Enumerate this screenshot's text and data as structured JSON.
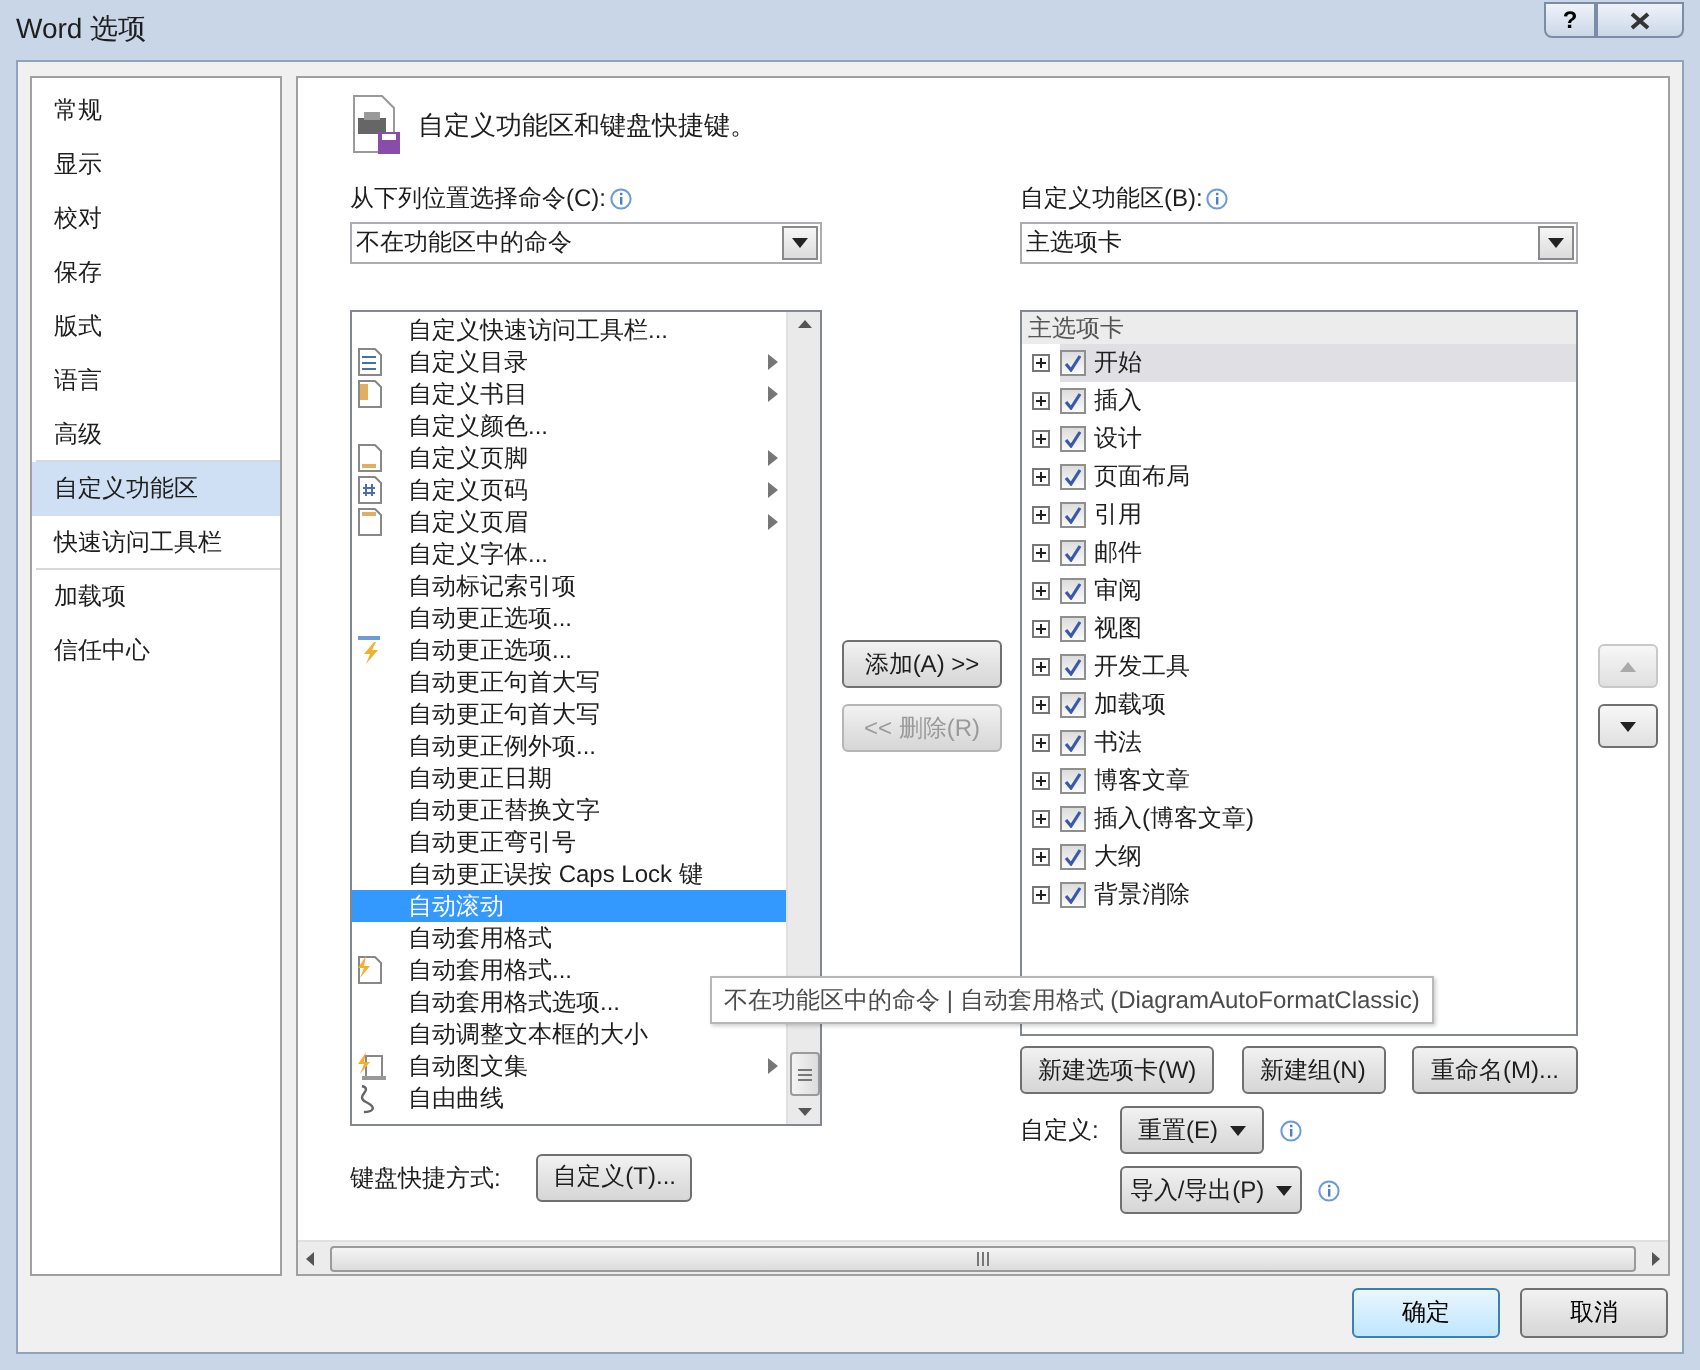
{
  "window": {
    "title": "Word 选项",
    "help_label": "?"
  },
  "nav": [
    {
      "label": "常规",
      "selected": false,
      "divider_after": false
    },
    {
      "label": "显示",
      "selected": false,
      "divider_after": false
    },
    {
      "label": "校对",
      "selected": false,
      "divider_after": false
    },
    {
      "label": "保存",
      "selected": false,
      "divider_after": false
    },
    {
      "label": "版式",
      "selected": false,
      "divider_after": false
    },
    {
      "label": "语言",
      "selected": false,
      "divider_after": false
    },
    {
      "label": "高级",
      "selected": false,
      "divider_after": true
    },
    {
      "label": "自定义功能区",
      "selected": true,
      "divider_after": false
    },
    {
      "label": "快速访问工具栏",
      "selected": false,
      "divider_after": true
    },
    {
      "label": "加载项",
      "selected": false,
      "divider_after": false
    },
    {
      "label": "信任中心",
      "selected": false,
      "divider_after": false
    }
  ],
  "heading": "自定义功能区和键盘快捷键。",
  "source": {
    "label": "从下列位置选择命令(C):",
    "value": "不在功能区中的命令"
  },
  "commands": [
    {
      "label": "自定义快速访问工具栏...",
      "kind": "plain",
      "selected": false
    },
    {
      "label": "自定义目录",
      "kind": "document",
      "submenu": true,
      "selected": false
    },
    {
      "label": "自定义书目",
      "kind": "bibliography",
      "submenu": true,
      "selected": false
    },
    {
      "label": "自定义颜色...",
      "kind": "plain",
      "selected": false
    },
    {
      "label": "自定义页脚",
      "kind": "footer",
      "submenu": true,
      "selected": false
    },
    {
      "label": "自定义页码",
      "kind": "page-number",
      "submenu": true,
      "selected": false
    },
    {
      "label": "自定义页眉",
      "kind": "header",
      "submenu": true,
      "selected": false
    },
    {
      "label": "自定义字体...",
      "kind": "plain",
      "selected": false
    },
    {
      "label": "自动标记索引项",
      "kind": "plain",
      "selected": false
    },
    {
      "label": "自动更正选项...",
      "kind": "plain",
      "selected": false
    },
    {
      "label": "自动更正选项...",
      "kind": "lightning",
      "selected": false
    },
    {
      "label": "自动更正句首大写",
      "kind": "plain",
      "selected": false
    },
    {
      "label": "自动更正句首大写",
      "kind": "plain",
      "selected": false
    },
    {
      "label": "自动更正例外项...",
      "kind": "plain",
      "selected": false
    },
    {
      "label": "自动更正日期",
      "kind": "plain",
      "selected": false
    },
    {
      "label": "自动更正替换文字",
      "kind": "plain",
      "selected": false
    },
    {
      "label": "自动更正弯引号",
      "kind": "plain",
      "selected": false
    },
    {
      "label": "自动更正误按 Caps Lock 键",
      "kind": "plain",
      "selected": false
    },
    {
      "label": "自动滚动",
      "kind": "plain",
      "selected": true
    },
    {
      "label": "自动套用格式",
      "kind": "plain",
      "selected": false
    },
    {
      "label": "自动套用格式...",
      "kind": "autoformat",
      "selected": false
    },
    {
      "label": "自动套用格式选项...",
      "kind": "plain",
      "selected": false
    },
    {
      "label": "自动调整文本框的大小",
      "kind": "plain",
      "selected": false
    },
    {
      "label": "自动图文集",
      "kind": "autotext",
      "submenu": true,
      "selected": false
    },
    {
      "label": "自由曲线",
      "kind": "freeform",
      "selected": false
    }
  ],
  "add_button": {
    "label": "添加(A) >>",
    "disabled": false
  },
  "remove_button": {
    "label": "<< 删除(R)",
    "disabled": true
  },
  "target": {
    "label": "自定义功能区(B):",
    "value": "主选项卡"
  },
  "tree": {
    "header": "主选项卡",
    "items": [
      {
        "label": "开始",
        "checked": true,
        "expanded": false,
        "selected": true
      },
      {
        "label": "插入",
        "checked": true,
        "expanded": false,
        "selected": false
      },
      {
        "label": "设计",
        "checked": true,
        "expanded": false,
        "selected": false
      },
      {
        "label": "页面布局",
        "checked": true,
        "expanded": false,
        "selected": false
      },
      {
        "label": "引用",
        "checked": true,
        "expanded": false,
        "selected": false
      },
      {
        "label": "邮件",
        "checked": true,
        "expanded": false,
        "selected": false
      },
      {
        "label": "审阅",
        "checked": true,
        "expanded": false,
        "selected": false
      },
      {
        "label": "视图",
        "checked": true,
        "expanded": false,
        "selected": false
      },
      {
        "label": "开发工具",
        "checked": true,
        "expanded": false,
        "selected": false
      },
      {
        "label": "加载项",
        "checked": true,
        "expanded": false,
        "selected": false
      },
      {
        "label": "书法",
        "checked": true,
        "expanded": false,
        "selected": false
      },
      {
        "label": "博客文章",
        "checked": true,
        "expanded": false,
        "selected": false
      },
      {
        "label": "插入(博客文章)",
        "checked": true,
        "expanded": false,
        "selected": false
      },
      {
        "label": "大纲",
        "checked": true,
        "expanded": false,
        "selected": false
      },
      {
        "label": "背景消除",
        "checked": true,
        "expanded": false,
        "selected": false
      }
    ]
  },
  "tree_buttons": [
    "新建选项卡(W)",
    "新建组(N)",
    "重命名(M)..."
  ],
  "customize": {
    "label": "自定义:",
    "reset": "重置(E)",
    "import_export": "导入/导出(P)"
  },
  "keyboard": {
    "label": "键盘快捷方式:",
    "button": "自定义(T)..."
  },
  "tooltip": "不在功能区中的命令 | 自动套用格式 (DiagramAutoFormatClassic)",
  "footer": {
    "ok": "确定",
    "cancel": "取消"
  }
}
